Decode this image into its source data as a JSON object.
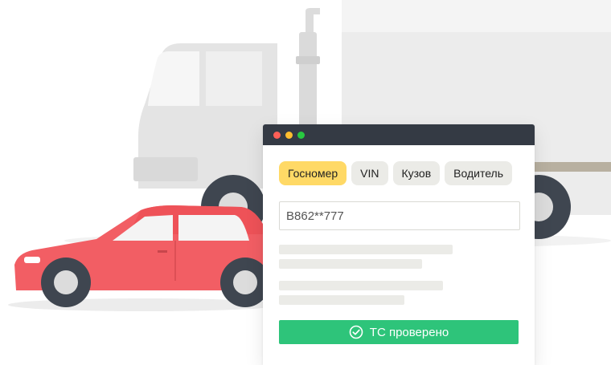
{
  "window": {
    "dots": [
      "#ff5f57",
      "#ffbd2e",
      "#28c840"
    ],
    "tabs": [
      {
        "label": "Госномер",
        "active": true
      },
      {
        "label": "VIN",
        "active": false
      },
      {
        "label": "Кузов",
        "active": false
      },
      {
        "label": "Водитель",
        "active": false
      }
    ],
    "search": {
      "value": "B862**777"
    },
    "status": {
      "label": "ТС проверено",
      "icon": "check-circle-icon",
      "color": "#2ec47a"
    }
  },
  "colors": {
    "accent_tab": "#ffd966",
    "car": "#f25e64",
    "truck": "#e6e6e6",
    "titlebar": "#343a44"
  },
  "illustration": {
    "vehicles": [
      "truck",
      "car"
    ]
  }
}
